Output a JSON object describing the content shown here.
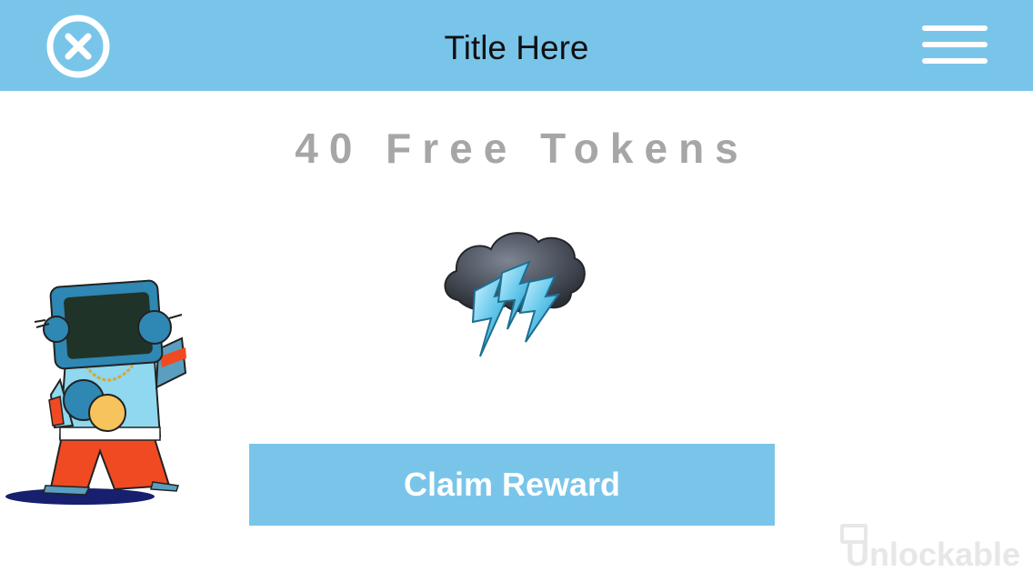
{
  "header": {
    "title": "Title Here",
    "close_icon": "close-circle-icon",
    "menu_icon": "hamburger-menu-icon",
    "background_color": "#79c5ea"
  },
  "reward": {
    "title": "40 Free Tokens",
    "image": "storm-cloud-lightning",
    "title_color": "#a6a6a6"
  },
  "mascot": {
    "image": "tv-head-character"
  },
  "claim_button": {
    "label": "Claim Reward",
    "color": "#79c5ea"
  },
  "watermark": {
    "text": "Unlockable"
  }
}
